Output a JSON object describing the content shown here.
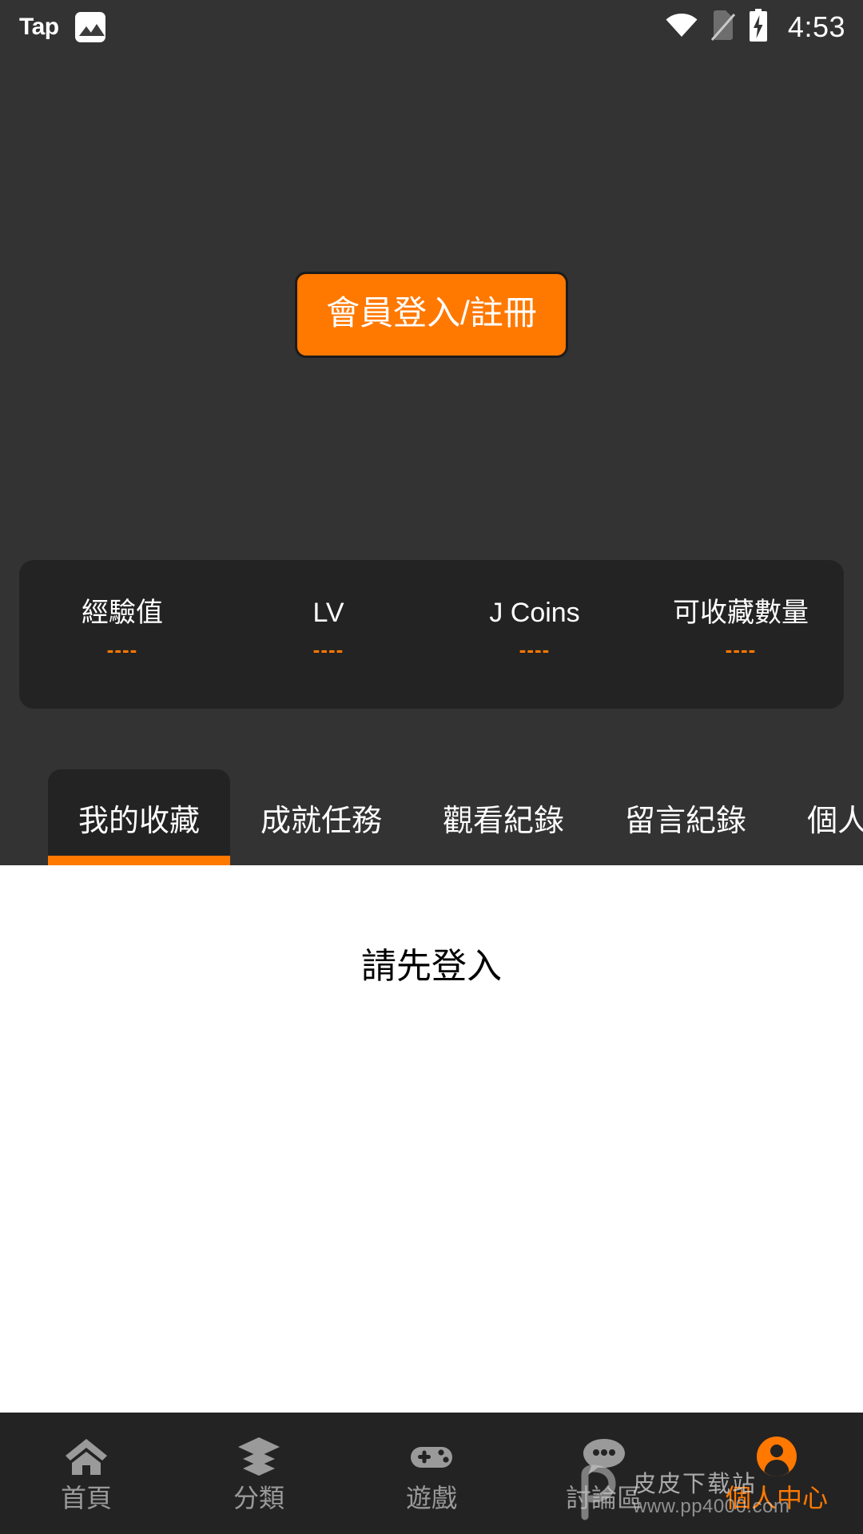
{
  "statusbar": {
    "app_name": "Tap",
    "photo_icon": "image-icon",
    "wifi_icon": "wifi-icon",
    "sim_icon": "no-sim-icon",
    "battery_icon": "battery-charging-icon",
    "time": "4:53"
  },
  "login": {
    "button_label": "會員登入/註冊",
    "accent_color": "#FF7800"
  },
  "stats": [
    {
      "label": "經驗值",
      "value": "----"
    },
    {
      "label": "LV",
      "value": "----"
    },
    {
      "label": "J Coins",
      "value": "----"
    },
    {
      "label": "可收藏數量",
      "value": "----"
    }
  ],
  "tabs": [
    {
      "label": "我的收藏",
      "active": true
    },
    {
      "label": "成就任務",
      "active": false
    },
    {
      "label": "觀看紀錄",
      "active": false
    },
    {
      "label": "留言紀錄",
      "active": false
    },
    {
      "label": "個人資料",
      "active": false
    }
  ],
  "content": {
    "message": "請先登入"
  },
  "bottom_nav": [
    {
      "label": "首頁",
      "icon": "home-icon",
      "active": false
    },
    {
      "label": "分類",
      "icon": "layers-icon",
      "active": false
    },
    {
      "label": "遊戲",
      "icon": "gamepad-icon",
      "active": false
    },
    {
      "label": "討論區",
      "icon": "chat-bubble-icon",
      "active": false
    },
    {
      "label": "個人中心",
      "icon": "person-icon",
      "active": true
    }
  ],
  "watermark": {
    "site_name": "皮皮下载站",
    "url": "www.pp4000.com"
  }
}
